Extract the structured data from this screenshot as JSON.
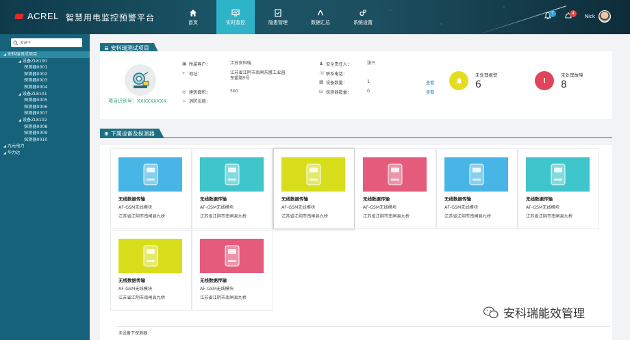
{
  "header": {
    "logo_text": "ACREL",
    "platform_title": "智慧用电监控预警平台",
    "nav": [
      {
        "label": "首页",
        "icon": "home-icon"
      },
      {
        "label": "实时监控",
        "icon": "monitor-icon",
        "active": true
      },
      {
        "label": "隐患管理",
        "icon": "checklist-icon"
      },
      {
        "label": "数据汇总",
        "icon": "chart-icon"
      },
      {
        "label": "系统设置",
        "icon": "settings-icon"
      }
    ],
    "alerts_count": "7",
    "faults_count": "4",
    "user_name": "Nick"
  },
  "sidebar": {
    "search_placeholder": "关键字",
    "tree": [
      {
        "label": "安科瑞测试项目",
        "level": 0,
        "expanded": true,
        "selected": true
      },
      {
        "label": "设备ZL8100",
        "level": 1,
        "expanded": true
      },
      {
        "label": "探测器0001",
        "level": 2
      },
      {
        "label": "探测器0002",
        "level": 2
      },
      {
        "label": "探测器0003",
        "level": 2
      },
      {
        "label": "探测器0004",
        "level": 2
      },
      {
        "label": "设备ZL8101",
        "level": 1,
        "expanded": true
      },
      {
        "label": "探测器0005",
        "level": 2
      },
      {
        "label": "探测器0006",
        "level": 2
      },
      {
        "label": "探测器0007",
        "level": 2
      },
      {
        "label": "设备ZL8102",
        "level": 1,
        "expanded": true
      },
      {
        "label": "探测器0008",
        "level": 2
      },
      {
        "label": "探测器0009",
        "level": 2
      },
      {
        "label": "探测器0010",
        "level": 2
      },
      {
        "label": "九元电力",
        "level": 0,
        "expanded": true
      },
      {
        "label": "华力达",
        "level": 0,
        "expanded": true
      }
    ]
  },
  "project": {
    "section_title": "安科瑞测试项目",
    "id_label": "项目识别号：XXXXXXXXX",
    "left_fields": [
      {
        "icon": "id-card-icon",
        "label": "所属客户：",
        "value": "江苏安科瑞"
      },
      {
        "icon": "location-icon",
        "label": "地址：",
        "value": "江苏省江阴市南闸东盟工业园东盟路5号"
      },
      {
        "icon": "area-icon",
        "label": "建筑面积：",
        "value": "500"
      },
      {
        "icon": "fire-icon",
        "label": "消防设施：",
        "value": ""
      }
    ],
    "right_fields": [
      {
        "icon": "person-icon",
        "label": "安全责任人：",
        "value": "张三",
        "link": ""
      },
      {
        "icon": "phone-icon",
        "label": "联系电话：",
        "value": "",
        "link": ""
      },
      {
        "icon": "device-icon",
        "label": "设备数量：",
        "value": "1",
        "link": "查看"
      },
      {
        "icon": "detector-icon",
        "label": "探测器数量：",
        "value": "0",
        "link": "查看"
      }
    ],
    "alarms": {
      "label": "未处理报警",
      "count": "6",
      "color": "#e6dc1f"
    },
    "faults": {
      "label": "未处理故障",
      "count": "8",
      "color": "#e2445a"
    }
  },
  "devices": {
    "section_title": "下属设备及探测器",
    "cards": [
      {
        "title": "无线数据传输",
        "model": "AF-GSM无线模块",
        "address": "江苏省江阴市南闸县九桥",
        "color": "#47b6e6",
        "active": false
      },
      {
        "title": "无线数据传输",
        "model": "AF-GSM无线模块",
        "address": "江苏省江阴市南闸县九桥",
        "color": "#3fc6cc",
        "active": false
      },
      {
        "title": "无线数据传输",
        "model": "AF-GSM无线模块",
        "address": "江苏省江阴市南闸县九桥",
        "color": "#d8de1c",
        "active": true
      },
      {
        "title": "无线数据传输",
        "model": "AF-GSM无线模块",
        "address": "江苏省江阴市南闸县九桥",
        "color": "#e45b7c",
        "active": false
      },
      {
        "title": "无线数据传输",
        "model": "AF-GSM无线模块",
        "address": "江苏省江阴市南闸县九桥",
        "color": "#47b6e6",
        "active": false
      },
      {
        "title": "无线数据传输",
        "model": "AF-GSM无线模块",
        "address": "江苏省江阴市南闸县九桥",
        "color": "#3fc6cc",
        "active": false
      },
      {
        "title": "无线数据传输",
        "model": "AF-GSM无线模块",
        "address": "江苏省江阴市南闸县九桥",
        "color": "#d8de1c",
        "active": false
      },
      {
        "title": "无线数据传输",
        "model": "AF-GSM无线模块",
        "address": "江苏省江阴市南闸县九桥",
        "color": "#e45b7c",
        "active": false
      }
    ],
    "footer_text": "未设备下探测器："
  },
  "watermark": "安科瑞能效管理"
}
